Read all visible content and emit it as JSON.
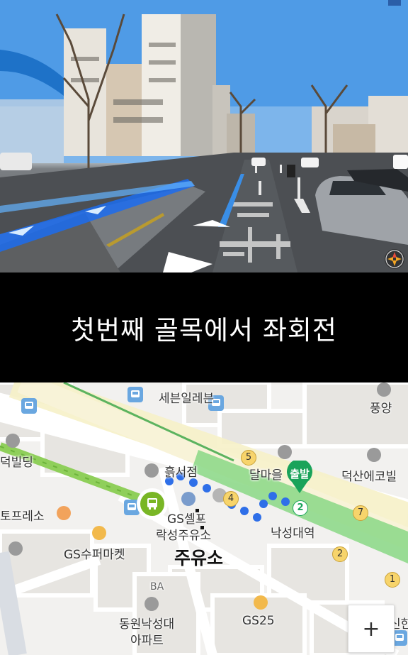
{
  "instruction": {
    "text": "첫번째 골목에서 좌회전"
  },
  "map": {
    "labels": {
      "seven_eleven": "세븐일레븐",
      "pungyang": "풍양",
      "deokbilding": "덕빌딩",
      "heukseojeom": "흙서점",
      "dalmamaeul": "달마을",
      "deoksan_ecobil": "덕산에코빌",
      "start": "출발",
      "espresso": "토프레소",
      "gs_self": "GS셀프",
      "nakseong_gas": "락성주유소",
      "nakseongdae_station": "낙성대역",
      "gs_supermarket": "GS수퍼마켓",
      "gas_station_big": "주유소",
      "dongwon_apt_line1": "동원낙성대",
      "dongwon_apt_line2": "아파트",
      "gs25": "GS25",
      "sinhan": "신한",
      "ba": "BA"
    },
    "exit_numbers": {
      "e5": "5",
      "e4": "4",
      "e7": "7",
      "e2": "2",
      "e1": "1",
      "route2": "2"
    },
    "zoom_in_label": "+",
    "colors": {
      "route": "#2f6fe8",
      "bus_stop": "#79b625",
      "start": "#1aa35a",
      "subway_line": "#5cc36a"
    }
  }
}
